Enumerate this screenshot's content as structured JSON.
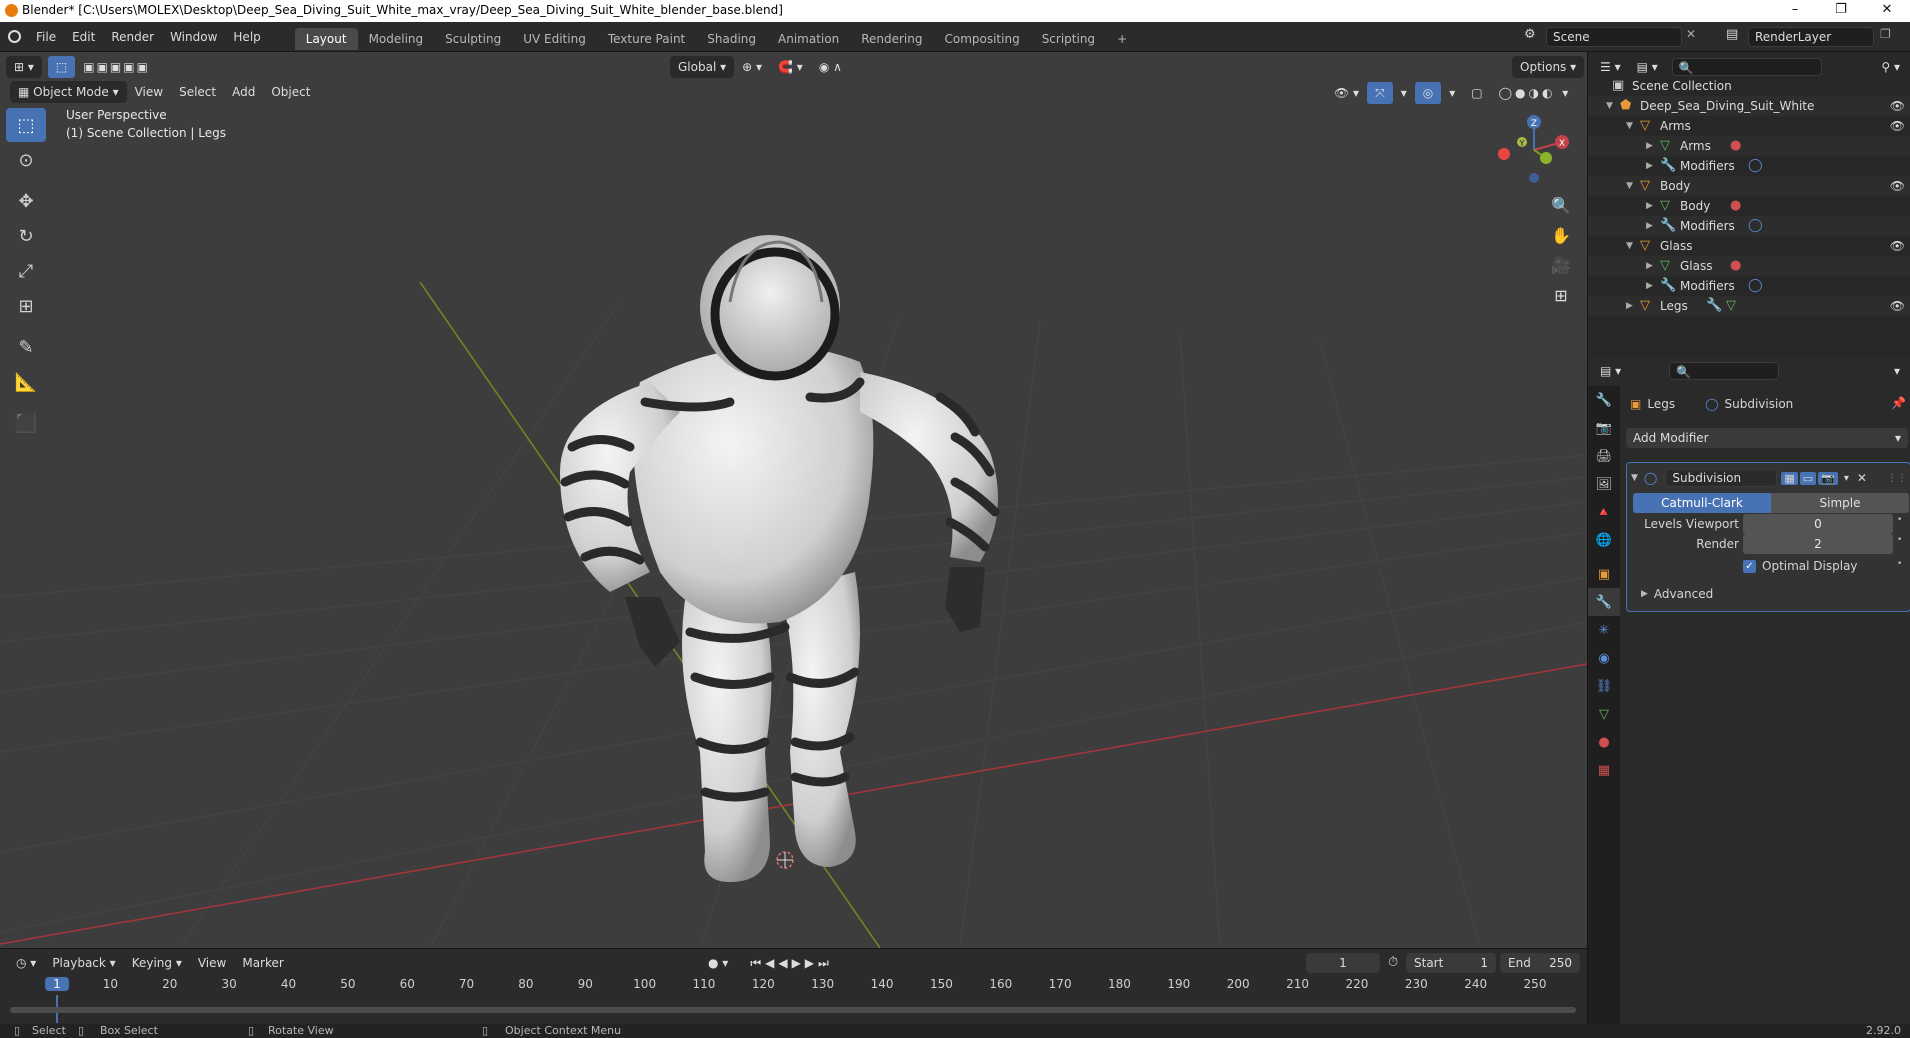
{
  "titlebar": {
    "title": "Blender* [C:\\Users\\MOLEX\\Desktop\\Deep_Sea_Diving_Suit_White_max_vray/Deep_Sea_Diving_Suit_White_blender_base.blend]",
    "minimize": "–",
    "restore": "❐",
    "close": "✕"
  },
  "menu": [
    "File",
    "Edit",
    "Render",
    "Window",
    "Help"
  ],
  "workspaces": [
    "Layout",
    "Modeling",
    "Sculpting",
    "UV Editing",
    "Texture Paint",
    "Shading",
    "Animation",
    "Rendering",
    "Compositing",
    "Scripting"
  ],
  "workspace_add": "+",
  "scene": {
    "name": "Scene",
    "render_layer": "RenderLayer"
  },
  "viewport": {
    "mode": "Object Mode",
    "menus": [
      "View",
      "Select",
      "Add",
      "Object"
    ],
    "transform_orientation": "Global",
    "options": "Options",
    "overlay_line1": "User Perspective",
    "overlay_line2": "(1) Scene Collection | Legs",
    "gizmo": {
      "x": "X",
      "y": "Y",
      "z": "Z"
    },
    "colors": {
      "bg": "#3d3d3d",
      "x_axis": "#b8343a",
      "y_axis": "#7a9a1f",
      "accent": "#4772b3"
    }
  },
  "timeline": {
    "menus": [
      "Playback",
      "Keying",
      "View",
      "Marker"
    ],
    "current_frame": "1",
    "start_label": "Start",
    "start": "1",
    "end_label": "End",
    "end": "250",
    "ticks": [
      "1",
      "10",
      "20",
      "30",
      "40",
      "50",
      "60",
      "70",
      "80",
      "90",
      "100",
      "110",
      "120",
      "130",
      "140",
      "150",
      "160",
      "170",
      "180",
      "190",
      "200",
      "210",
      "220",
      "230",
      "240",
      "250"
    ]
  },
  "statusbar": {
    "select": "Select",
    "box_select": "Box Select",
    "rotate_view": "Rotate View",
    "context_menu": "Object Context Menu",
    "version": "2.92.0"
  },
  "outliner": {
    "root": "Scene Collection",
    "items": [
      {
        "label": "Deep_Sea_Diving_Suit_White",
        "depth": 1,
        "type": "collection"
      },
      {
        "label": "Arms",
        "depth": 2,
        "type": "object"
      },
      {
        "label": "Arms",
        "depth": 3,
        "type": "mesh"
      },
      {
        "label": "Modifiers",
        "depth": 3,
        "type": "modifiers"
      },
      {
        "label": "Body",
        "depth": 2,
        "type": "object"
      },
      {
        "label": "Body",
        "depth": 3,
        "type": "mesh"
      },
      {
        "label": "Modifiers",
        "depth": 3,
        "type": "modifiers"
      },
      {
        "label": "Glass",
        "depth": 2,
        "type": "object"
      },
      {
        "label": "Glass",
        "depth": 3,
        "type": "mesh"
      },
      {
        "label": "Modifiers",
        "depth": 3,
        "type": "modifiers"
      },
      {
        "label": "Legs",
        "depth": 2,
        "type": "object"
      }
    ]
  },
  "properties": {
    "breadcrumb_object": "Legs",
    "breadcrumb_modifier": "Subdivision",
    "add_modifier": "Add Modifier",
    "modifier": {
      "name": "Subdivision",
      "type_a": "Catmull-Clark",
      "type_b": "Simple",
      "levels_viewport_label": "Levels Viewport",
      "levels_viewport": "0",
      "render_label": "Render",
      "render": "2",
      "optimal_display": "Optimal Display",
      "advanced": "Advanced"
    }
  }
}
